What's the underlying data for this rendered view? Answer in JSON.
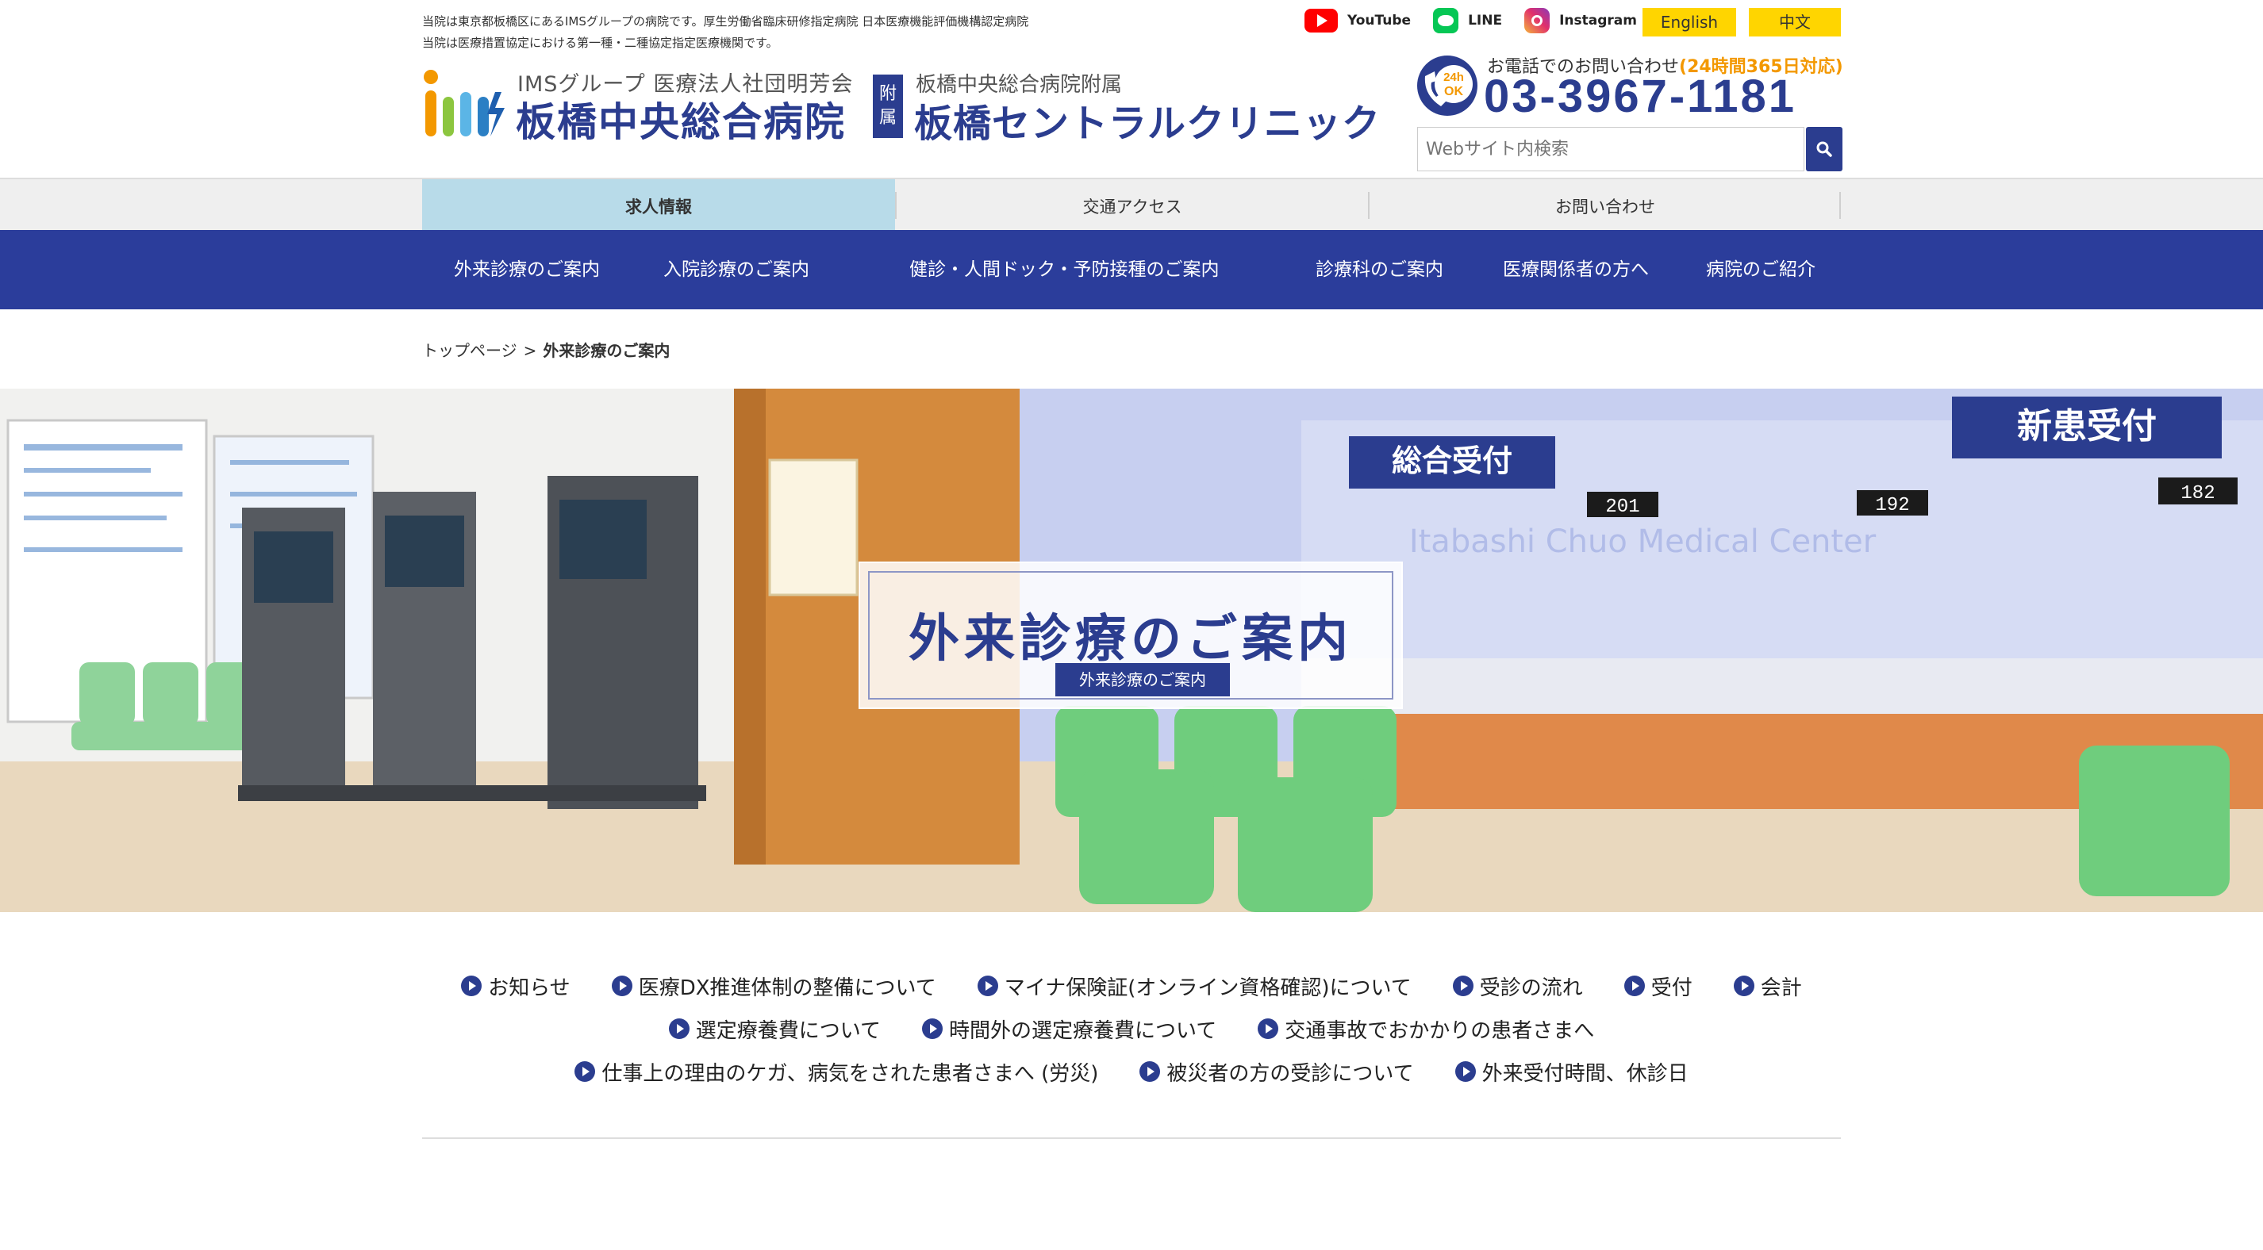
{
  "notice": {
    "line1": "当院は東京都板橋区にあるIMSグループの病院です。厚生労働省臨床研修指定病院 日本医療機能評価機構認定病院",
    "line2": "当院は医療措置協定における第一種・二種協定指定医療機関です。"
  },
  "sns": {
    "youtube": "YouTube",
    "line": "LINE",
    "instagram": "Instagram"
  },
  "lang": {
    "english": "English",
    "chinese": "中文"
  },
  "logo1": {
    "sub": "IMSグループ 医療法人社団明芳会",
    "main": "板橋中央総合病院"
  },
  "logo2": {
    "badge_1": "附",
    "badge_2": "属",
    "sub": "板橋中央総合病院附属",
    "main": "板橋セントラルクリニック"
  },
  "contact": {
    "label": "お電話でのお問い合わせ",
    "hours": "(24時間365日対応)",
    "phone": "03-3967-1181",
    "badge_top": "24h",
    "badge_bottom": "OK"
  },
  "search": {
    "placeholder": "Webサイト内検索"
  },
  "subnav": [
    "求人情報",
    "交通アクセス",
    "お問い合わせ"
  ],
  "gnav": [
    "外来診療のご案内",
    "入院診療のご案内",
    "健診・人間ドック・予防接種のご案内",
    "診療科のご案内",
    "医療関係者の方へ",
    "病院のご紹介"
  ],
  "breadcrumb": {
    "home": "トップページ",
    "sep": ">",
    "current": "外来診療のご案内"
  },
  "hero": {
    "title": "外来診療のご案内",
    "subtitle": "外来診療のご案内",
    "sign_general": "総合受付",
    "sign_new": "新患受付",
    "counter_1": "201",
    "counter_2": "192",
    "counter_3": "182",
    "wall_text": "Itabashi Chuo Medical Center"
  },
  "links": {
    "row1": [
      "お知らせ",
      "医療DX推進体制の整備について",
      "マイナ保険証(オンライン資格確認)について",
      "受診の流れ",
      "受付",
      "会計"
    ],
    "row2": [
      "選定療養費について",
      "時間外の選定療養費について",
      "交通事故でおかかりの患者さまへ"
    ],
    "row3": [
      "仕事上の理由のケガ、病気をされた患者さまへ (労災)",
      "被災者の方の受診について",
      "外来受付時間、休診日"
    ]
  },
  "colors": {
    "brand": "#2b3d8f",
    "nav": "#2b3d9b",
    "accent": "#ffd500",
    "orange": "#f39800"
  }
}
